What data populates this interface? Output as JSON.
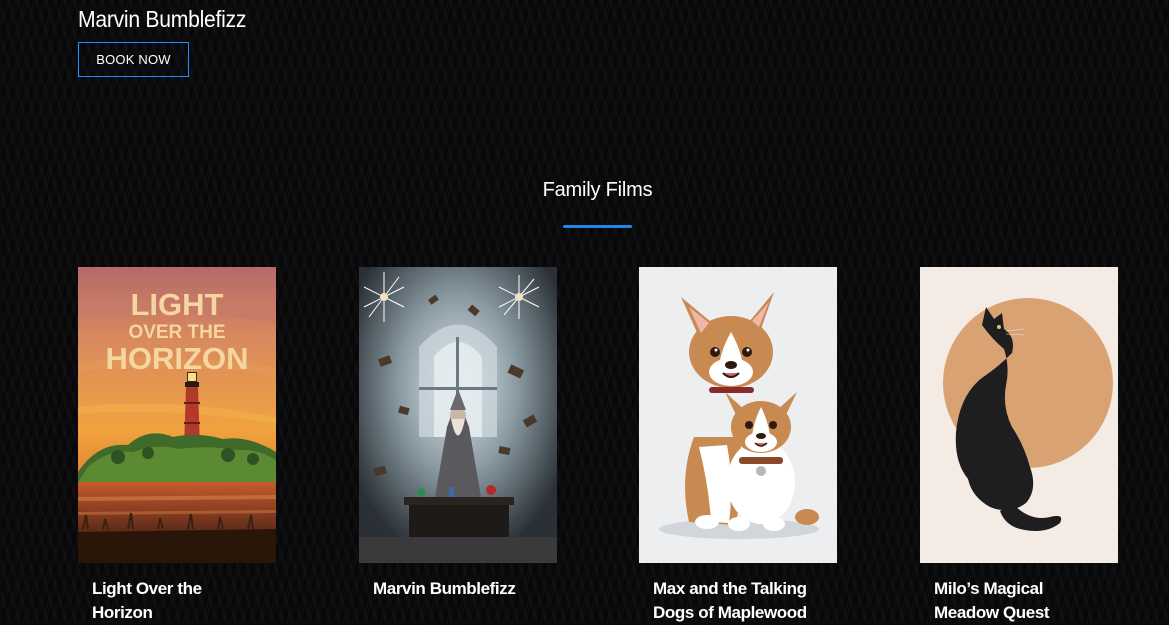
{
  "hero": {
    "title": "Marvin Bumblefizz",
    "book_button_label": "BOOK NOW"
  },
  "section": {
    "title": "Family Films",
    "accent_color": "#1e88e5"
  },
  "films": [
    {
      "title": "Light Over the Horizon",
      "poster_text_line1": "LIGHT",
      "poster_text_line2": "OVER THE",
      "poster_text_line3": "HORIZON",
      "poster_icon": "lighthouse-poster"
    },
    {
      "title": "Marvin Bumblefizz",
      "poster_icon": "wizard-poster"
    },
    {
      "title": "Max and the Talking Dogs of Maplewood",
      "poster_icon": "dogs-poster"
    },
    {
      "title": "Milo’s Magical Meadow Quest",
      "poster_icon": "cat-poster"
    }
  ]
}
